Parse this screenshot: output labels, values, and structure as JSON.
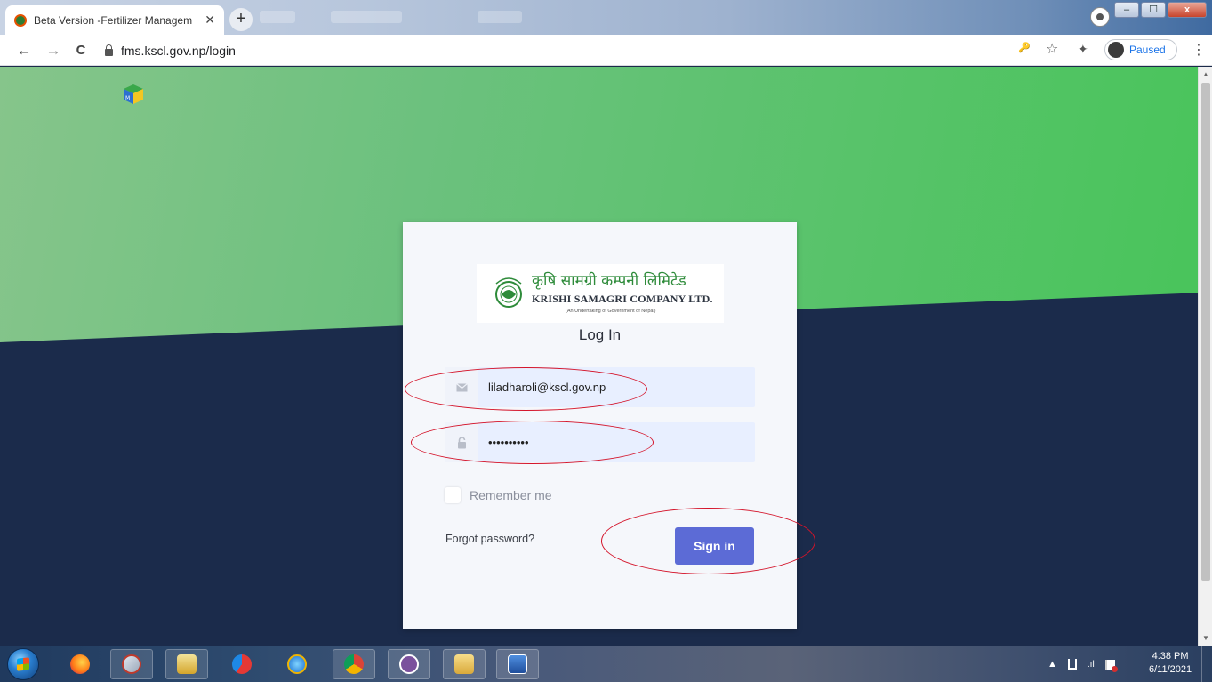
{
  "browser": {
    "tab_title": "Beta Version -Fertilizer Managem",
    "tab_close": "✕",
    "new_tab": "+",
    "url": "fms.kscl.gov.np/login",
    "profile_status": "Paused",
    "window_buttons": {
      "minimize": "–",
      "maximize": "☐",
      "close": "x"
    }
  },
  "toolbar_icons": {
    "back": "←",
    "forward": "→",
    "reload": "C",
    "key": "🔑",
    "star": "☆",
    "extensions": "✦",
    "menu": "⋮"
  },
  "brand": {
    "name_np": "कृषि सामग्री कम्पनी लिमिटेड",
    "name_en": "KRISHI SAMAGRI COMPANY LTD.",
    "subtitle": "(An Undertaking of Government of Nepal)"
  },
  "login": {
    "title": "Log In",
    "email_value": "liladharoli@kscl.gov.np",
    "password_value": "••••••••••",
    "remember_label": "Remember me",
    "forgot_label": "Forgot password?",
    "signin_label": "Sign in"
  },
  "taskbar": {
    "apps": [
      "firefox",
      "snipping-tool",
      "outlook",
      "ccleaner",
      "internet-explorer",
      "chrome",
      "viber",
      "file-explorer",
      "word"
    ],
    "time": "4:38 PM",
    "date": "6/11/2021",
    "tray_arrow": "▲"
  },
  "colors": {
    "primary_button": "#5c6bd6",
    "annotation": "#d4142a",
    "page_dark": "#1b2b4b",
    "page_green": "#58c36a"
  }
}
